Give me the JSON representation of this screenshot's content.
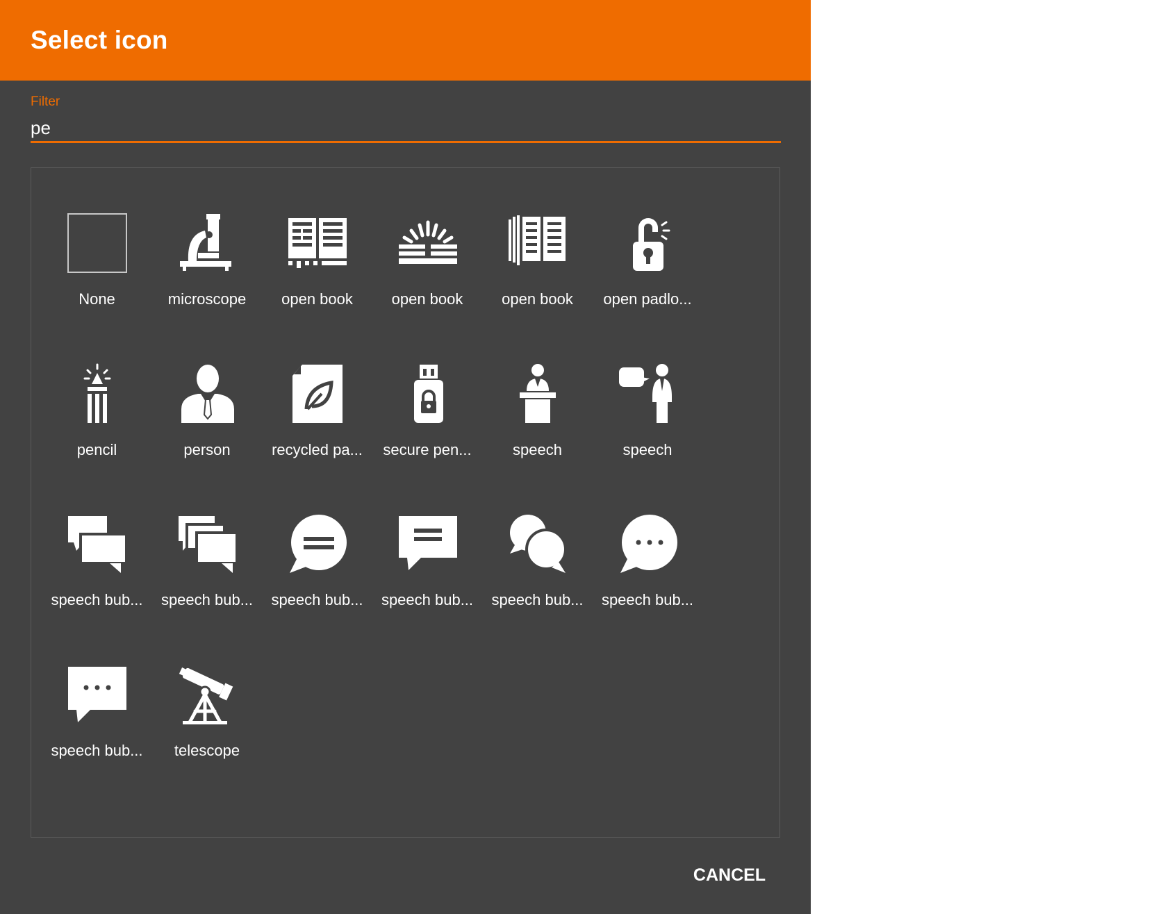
{
  "dialog": {
    "title": "Select icon",
    "accent_color": "#ef6c00",
    "background_color": "#424242",
    "cancel_label": "CANCEL"
  },
  "filter": {
    "label": "Filter",
    "value": "pe"
  },
  "icons": [
    {
      "label": "None",
      "icon": "none-placeholder-icon"
    },
    {
      "label": "microscope",
      "icon": "microscope-icon"
    },
    {
      "label": "open book",
      "icon": "open-book-icon"
    },
    {
      "label": "open book",
      "icon": "open-book-rays-icon"
    },
    {
      "label": "open book",
      "icon": "open-book-pages-icon"
    },
    {
      "label": "open padlo...",
      "icon": "open-padlock-icon"
    },
    {
      "label": "pencil",
      "icon": "pencil-icon"
    },
    {
      "label": "person",
      "icon": "person-icon"
    },
    {
      "label": "recycled pa...",
      "icon": "recycled-paper-icon"
    },
    {
      "label": "secure pen...",
      "icon": "secure-pen-drive-icon"
    },
    {
      "label": "speech",
      "icon": "speech-podium-icon"
    },
    {
      "label": "speech",
      "icon": "speech-person-icon"
    },
    {
      "label": "speech bub...",
      "icon": "speech-bubbles-icon"
    },
    {
      "label": "speech bub...",
      "icon": "speech-bubbles-outline-icon"
    },
    {
      "label": "speech bub...",
      "icon": "speech-bubble-round-lines-icon"
    },
    {
      "label": "speech bub...",
      "icon": "speech-bubble-square-lines-icon"
    },
    {
      "label": "speech bub...",
      "icon": "speech-bubbles-round-icon"
    },
    {
      "label": "speech bub...",
      "icon": "speech-bubble-round-dots-icon"
    },
    {
      "label": "speech bub...",
      "icon": "speech-bubble-square-dots-icon"
    },
    {
      "label": "telescope",
      "icon": "telescope-icon"
    }
  ]
}
